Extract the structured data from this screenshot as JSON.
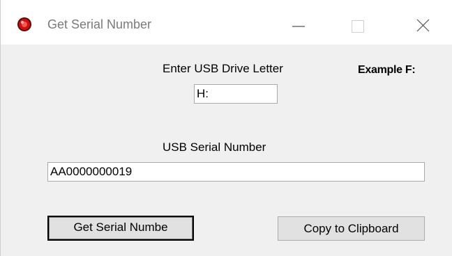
{
  "window": {
    "title": "Get Serial Number"
  },
  "form": {
    "drive_label": "Enter USB Drive Letter",
    "example_label": "Example F:",
    "drive_value": "H:",
    "serial_label": "USB Serial Number",
    "serial_value": "AA0000000019"
  },
  "buttons": {
    "get_serial": "Get Serial Numbe",
    "copy": "Copy to Clipboard"
  },
  "icons": {
    "app": "app-icon",
    "minimize": "minimize-icon",
    "maximize": "maximize-icon",
    "close": "close-icon"
  },
  "colors": {
    "window_bg": "#f0f0f0",
    "titlebar_bg": "#ffffff",
    "app_icon": "#cc1111"
  }
}
